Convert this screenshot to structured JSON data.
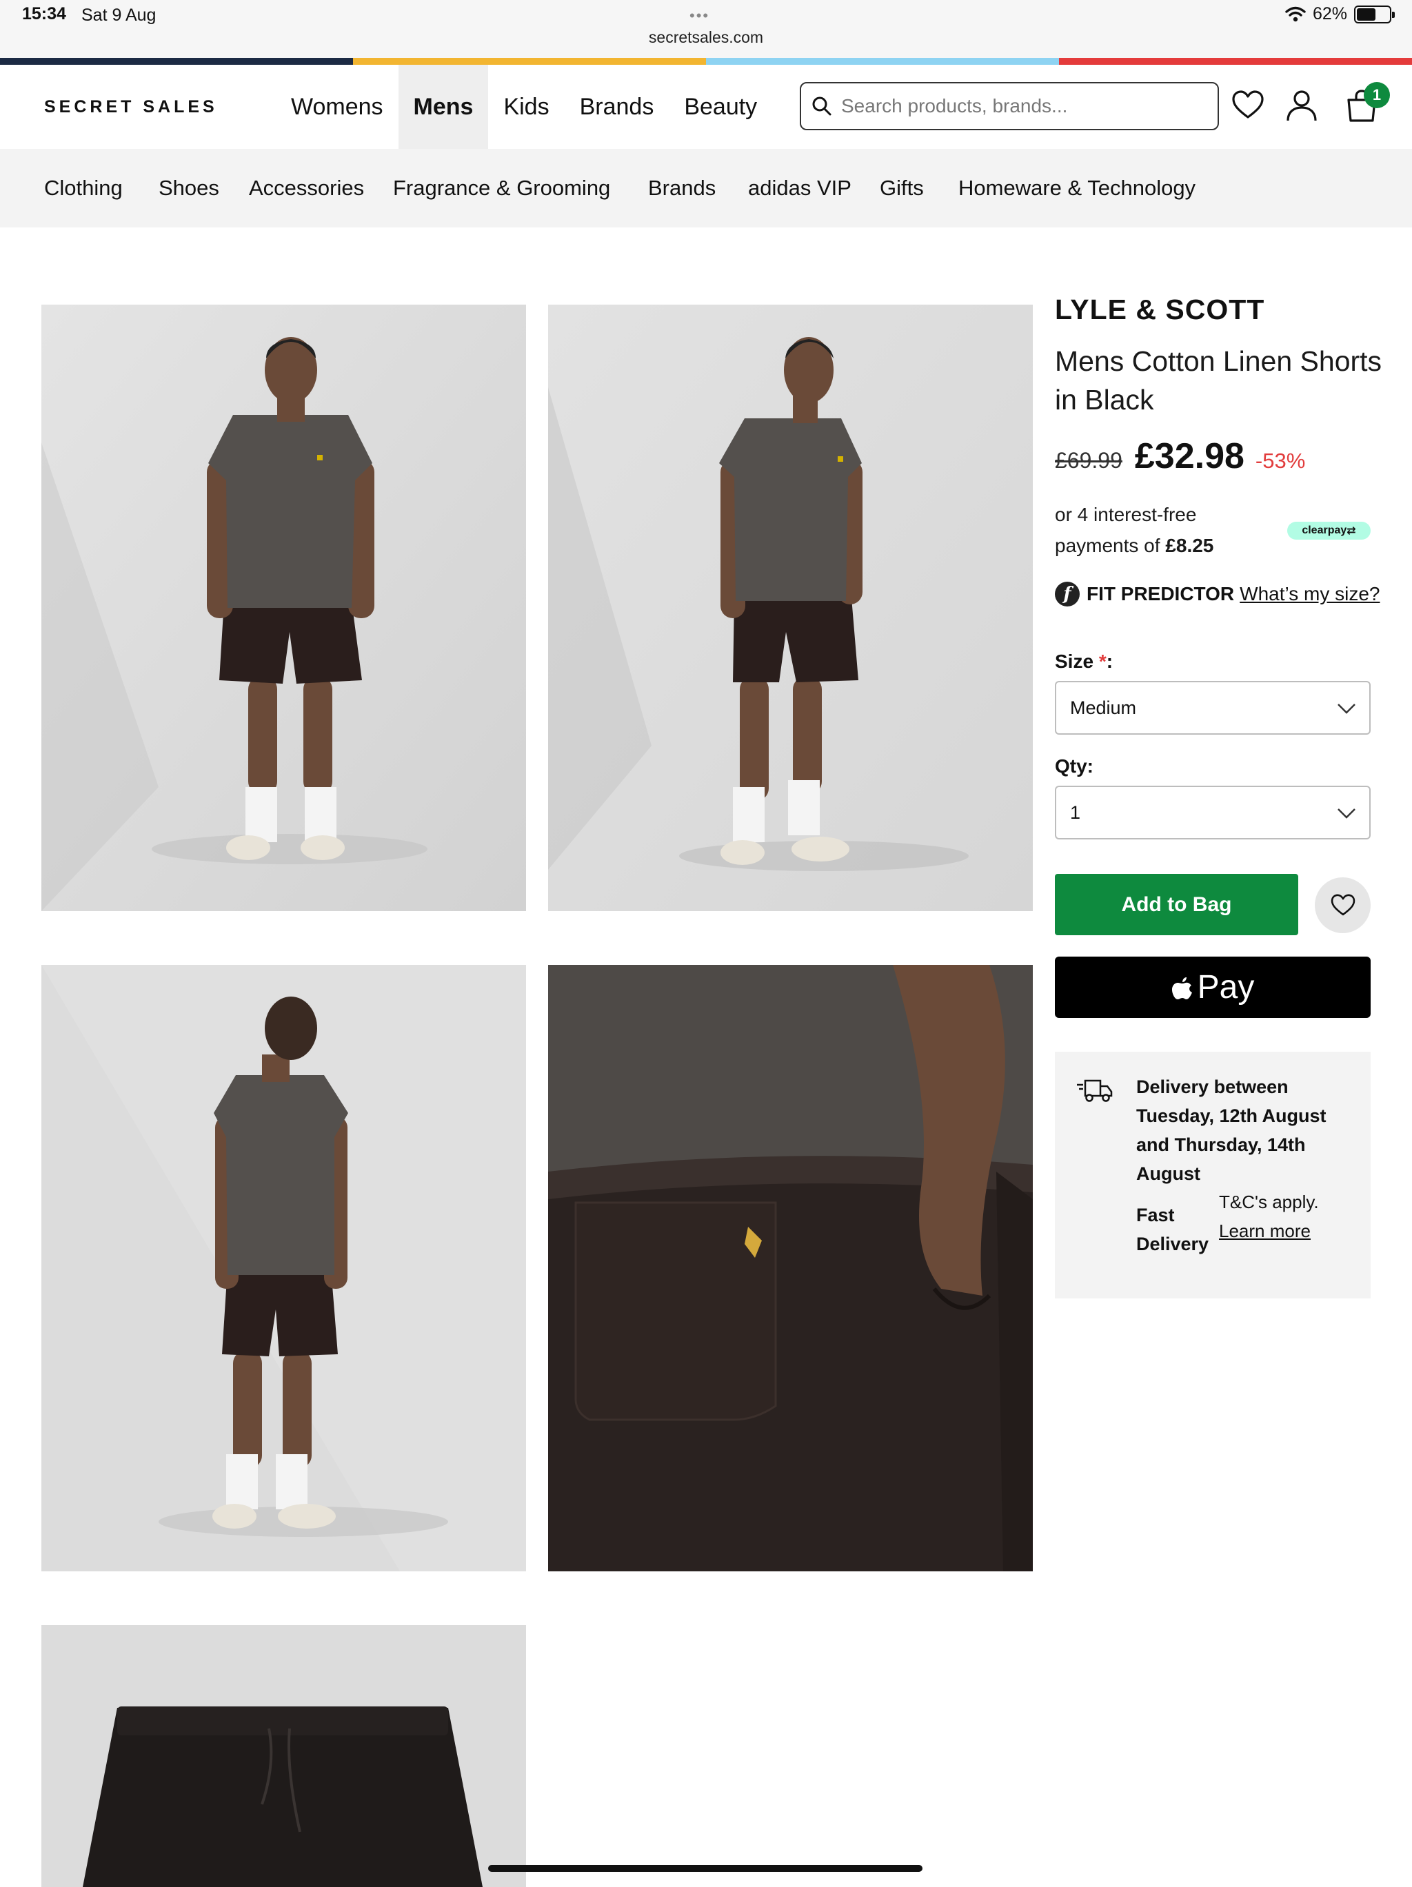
{
  "status_bar": {
    "time": "15:34",
    "date": "Sat 9 Aug",
    "url": "secretsales.com",
    "battery": "62%",
    "battery_level": 0.62
  },
  "stripe_colors": [
    "#1c2a44",
    "#f2b531",
    "#8ed3f2",
    "#e43b3b"
  ],
  "header": {
    "logo": "SECRET SALES",
    "nav": [
      "Womens",
      "Mens",
      "Kids",
      "Brands",
      "Beauty"
    ],
    "active_nav": "Mens",
    "search_placeholder": "Search products, brands...",
    "bag_count": "1"
  },
  "sub_nav": [
    "Clothing",
    "Shoes",
    "Accessories",
    "Fragrance & Grooming",
    "Brands",
    "adidas VIP",
    "Gifts",
    "Homeware & Technology"
  ],
  "product": {
    "brand": "LYLE & SCOTT",
    "name": "Mens Cotton Linen Shorts in Black",
    "old_price": "£69.99",
    "price": "£32.98",
    "discount": "-53%",
    "installments_text": "or 4 interest-free payments of",
    "installment_amount": "£8.25",
    "clearpay_label": "clearpay",
    "fit_label": "FIT PREDICTOR",
    "fit_link": "What’s my size?",
    "size_label": "Size",
    "size_value": "Medium",
    "qty_label": "Qty:",
    "qty_value": "1",
    "add_to_bag": "Add to Bag",
    "apple_pay": "Pay",
    "delivery": "Delivery between Tuesday, 12th August and Thursday, 14th August",
    "fast_delivery": "Fast Delivery",
    "tcs": "T&C's apply.",
    "learn_more": "Learn more"
  },
  "colors": {
    "accent_green": "#0e8a3e",
    "discount_red": "#e23d3d",
    "clearpay_mint": "#b2fce4"
  }
}
